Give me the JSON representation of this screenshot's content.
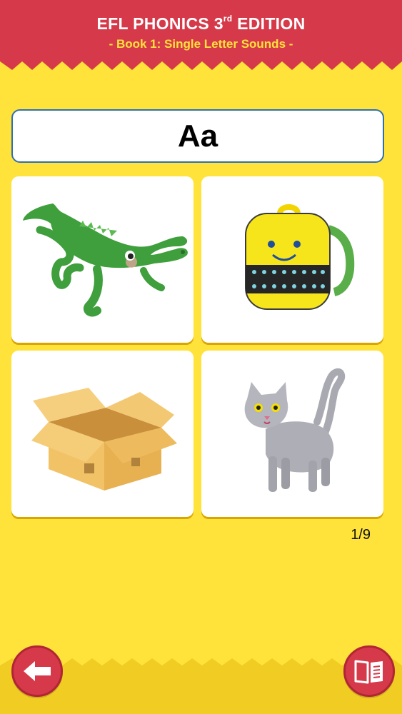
{
  "header": {
    "title_main": "EFL PHONICS 3",
    "title_sup": "rd",
    "title_rest": " EDITION",
    "subtitle": "- Book 1: Single Letter Sounds -"
  },
  "letter": "Aa",
  "cards": [
    {
      "icon": "alligator"
    },
    {
      "icon": "backpack"
    },
    {
      "icon": "box"
    },
    {
      "icon": "cat"
    }
  ],
  "page_indicator": "1/9",
  "buttons": {
    "back": {
      "icon": "back-arrow-icon"
    },
    "book": {
      "icon": "book-icon"
    }
  },
  "colors": {
    "header_red": "#D63A4A",
    "background_yellow": "#FFE23A",
    "footer_yellow": "#F1CD24",
    "letter_border": "#2F6FB0"
  }
}
